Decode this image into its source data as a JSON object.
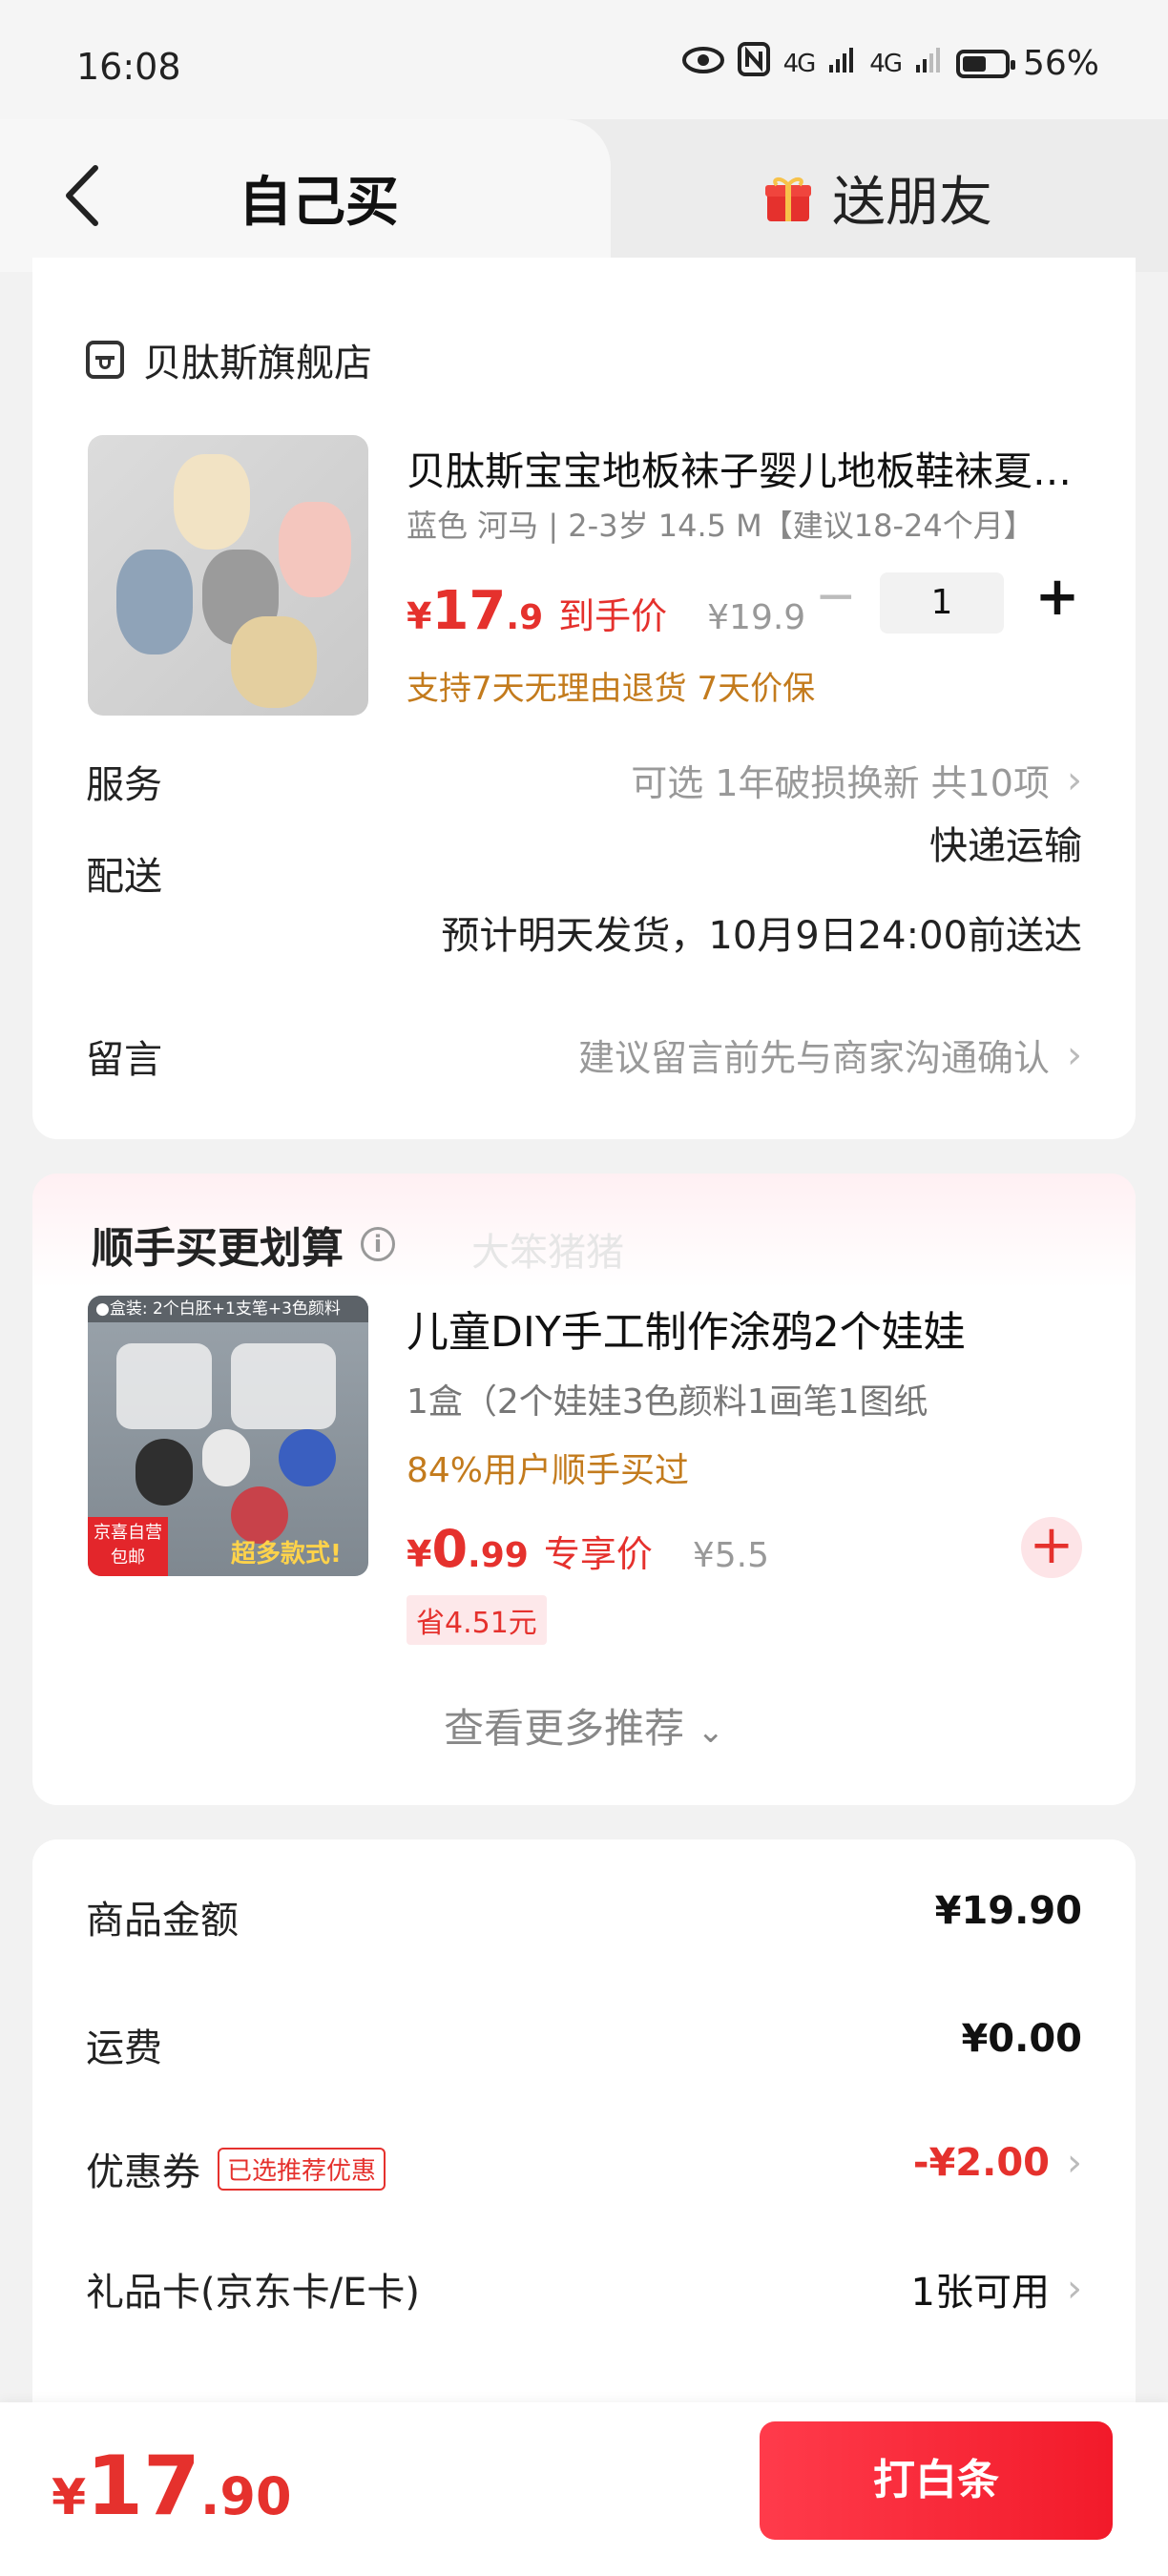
{
  "status_bar": {
    "time": "16:08",
    "network": "4G",
    "battery_text": "56%",
    "battery_level": 0.56
  },
  "tabs": {
    "self_buy": "自己买",
    "send_friend": "送朋友"
  },
  "store": {
    "name": "贝肽斯旗舰店"
  },
  "product": {
    "title": "贝肽斯宝宝地板袜子婴儿地板鞋袜夏季薄款",
    "spec": "蓝色 河马 | 2-3岁 14.5 M【建议18-24个月】",
    "price_currency": "¥",
    "price_int": "17",
    "price_dec": ".9",
    "price_tag": "到手价",
    "original_price": "¥19.9",
    "quantity": "1",
    "minus": "−",
    "plus": "+",
    "support": "支持7天无理由退货 7天价保"
  },
  "service": {
    "label": "服务",
    "value": "可选 1年破损换新 共10项"
  },
  "delivery": {
    "label": "配送",
    "method": "快递运输",
    "eta": "预计明天发货，10月9日24:00前送达"
  },
  "message": {
    "label": "留言",
    "placeholder": "建议留言前先与商家沟通确认"
  },
  "addon": {
    "title": "顺手买更划算",
    "watermark": "大笨猪猪",
    "image_strip": "●盒装: 2个白胚+1支笔+3色颜料",
    "image_badge": "京喜自营 包邮",
    "image_slogan": "超多款式!",
    "name": "儿童DIY手工制作涂鸦2个娃娃",
    "spec": "1盒（2个娃娃3色颜料1画笔1图纸",
    "buyers": "84%用户顺手买过",
    "price_currency": "¥",
    "price_int": "0",
    "price_dec": ".99",
    "price_tag": "专享价",
    "original_price": "¥5.5",
    "save": "省4.51元",
    "add": "+",
    "see_more": "查看更多推荐"
  },
  "summary": {
    "goods_label": "商品金额",
    "goods_value": "¥19.90",
    "shipping_label": "运费",
    "shipping_value": "¥0.00",
    "coupon_label": "优惠券",
    "coupon_badge": "已选推荐优惠",
    "coupon_value": "-¥2.00",
    "giftcard_label": "礼品卡(京东卡/E卡)",
    "giftcard_value": "1张可用"
  },
  "bottom": {
    "currency": "¥",
    "total_int": "17",
    "total_dec": ".90",
    "pay_label": "打白条"
  },
  "colors": {
    "accent": "#e5312d",
    "promo": "#c37b1d",
    "background": "#f2f2f2"
  },
  "icons": [
    "back-arrow-icon",
    "gift-icon",
    "store-icon",
    "info-icon",
    "chevron-right-icon",
    "chevron-down-icon",
    "plus-icon",
    "minus-icon",
    "eye-icon",
    "nfc-icon",
    "signal-icon",
    "battery-icon"
  ]
}
